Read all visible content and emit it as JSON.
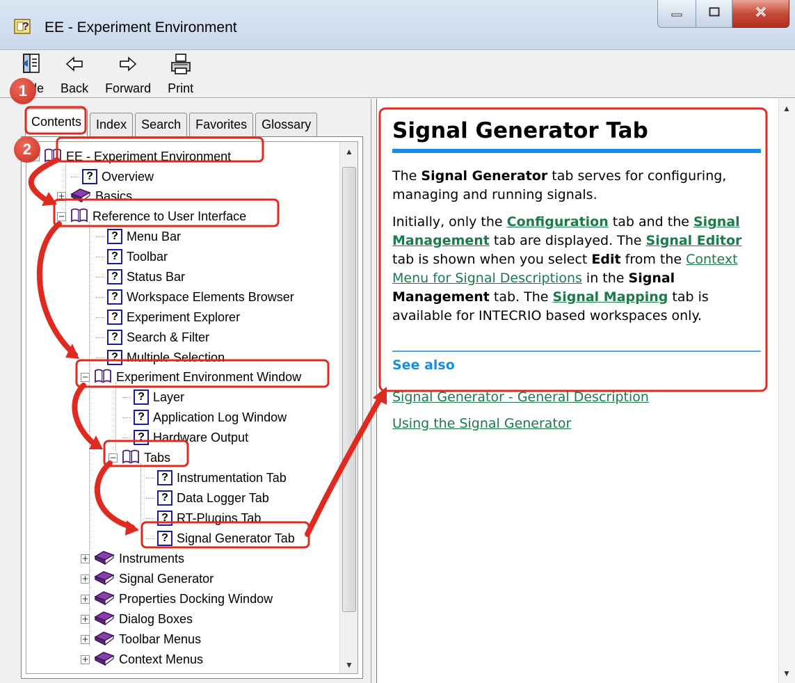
{
  "window": {
    "title": "EE - Experiment Environment",
    "controls": {
      "minimize": "minimize-icon",
      "maximize": "maximize-icon",
      "close": "close-icon"
    }
  },
  "toolbar": {
    "hide_label": "Hide",
    "back_label": "Back",
    "forward_label": "Forward",
    "print_label": "Print"
  },
  "nav_tabs": [
    "Contents",
    "Index",
    "Search",
    "Favorites",
    "Glossary"
  ],
  "tree": {
    "items": [
      {
        "label": "EE - Experiment Environment",
        "icon": "open-book-icon",
        "expander": "−"
      },
      {
        "label": "Overview",
        "icon": "help-topic-icon"
      },
      {
        "label": "Basics",
        "icon": "closed-book-icon",
        "expander": "+"
      },
      {
        "label": "Reference to User Interface",
        "icon": "open-book-icon",
        "expander": "−"
      },
      {
        "label": "Menu Bar",
        "icon": "help-topic-icon"
      },
      {
        "label": "Toolbar",
        "icon": "help-topic-icon"
      },
      {
        "label": "Status Bar",
        "icon": "help-topic-icon"
      },
      {
        "label": "Workspace Elements Browser",
        "icon": "help-topic-icon"
      },
      {
        "label": "Experiment Explorer",
        "icon": "help-topic-icon"
      },
      {
        "label": "Search & Filter",
        "icon": "help-topic-icon"
      },
      {
        "label": "Multiple Selection",
        "icon": "help-topic-icon"
      },
      {
        "label": "Experiment Environment Window",
        "icon": "open-book-icon",
        "expander": "−"
      },
      {
        "label": "Layer",
        "icon": "help-topic-icon"
      },
      {
        "label": "Application Log Window",
        "icon": "help-topic-icon"
      },
      {
        "label": "Hardware Output",
        "icon": "help-topic-icon"
      },
      {
        "label": "Tabs",
        "icon": "open-book-icon",
        "expander": "−"
      },
      {
        "label": "Instrumentation Tab",
        "icon": "help-topic-icon"
      },
      {
        "label": "Data Logger Tab",
        "icon": "help-topic-icon"
      },
      {
        "label": "RT-Plugins Tab",
        "icon": "help-topic-icon"
      },
      {
        "label": "Signal Generator Tab",
        "icon": "help-topic-icon"
      },
      {
        "label": "Instruments",
        "icon": "closed-book-icon",
        "expander": "+"
      },
      {
        "label": "Signal Generator",
        "icon": "closed-book-icon",
        "expander": "+"
      },
      {
        "label": "Properties Docking Window",
        "icon": "closed-book-icon",
        "expander": "+"
      },
      {
        "label": "Dialog Boxes",
        "icon": "closed-book-icon",
        "expander": "+"
      },
      {
        "label": "Toolbar Menus",
        "icon": "closed-book-icon",
        "expander": "+"
      },
      {
        "label": "Context Menus",
        "icon": "closed-book-icon",
        "expander": "+"
      }
    ]
  },
  "topic": {
    "heading": "Signal Generator Tab",
    "p1": {
      "t1": "The ",
      "b1": "Signal Generator",
      "t2": " tab serves for configuring, managing and running signals."
    },
    "p2": {
      "t1": "Initially, only the ",
      "l1": "Configuration",
      "t2": " tab and the ",
      "l2": "Signal Management",
      "t3": " tab are displayed. The ",
      "l3": "Signal Editor",
      "t4": " tab is shown when you select ",
      "b1": "Edit",
      "t5": " from the ",
      "l4": "Context Menu for Signal Descriptions",
      "t6": " in the ",
      "b2": "Signal Management",
      "t7": " tab. The ",
      "l5": "Signal Mapping",
      "t8": " tab is available for INTECRIO based workspaces only."
    },
    "see_also_heading": "See also",
    "see_also_links": [
      "Signal Generator - General Description",
      "Using the Signal Generator"
    ]
  },
  "annotations": {
    "badge1": "1",
    "badge2": "2"
  },
  "colors": {
    "annotation": "#e02a1f",
    "heading_rule": "#1b8ce3",
    "link": "#1a7a4a"
  }
}
